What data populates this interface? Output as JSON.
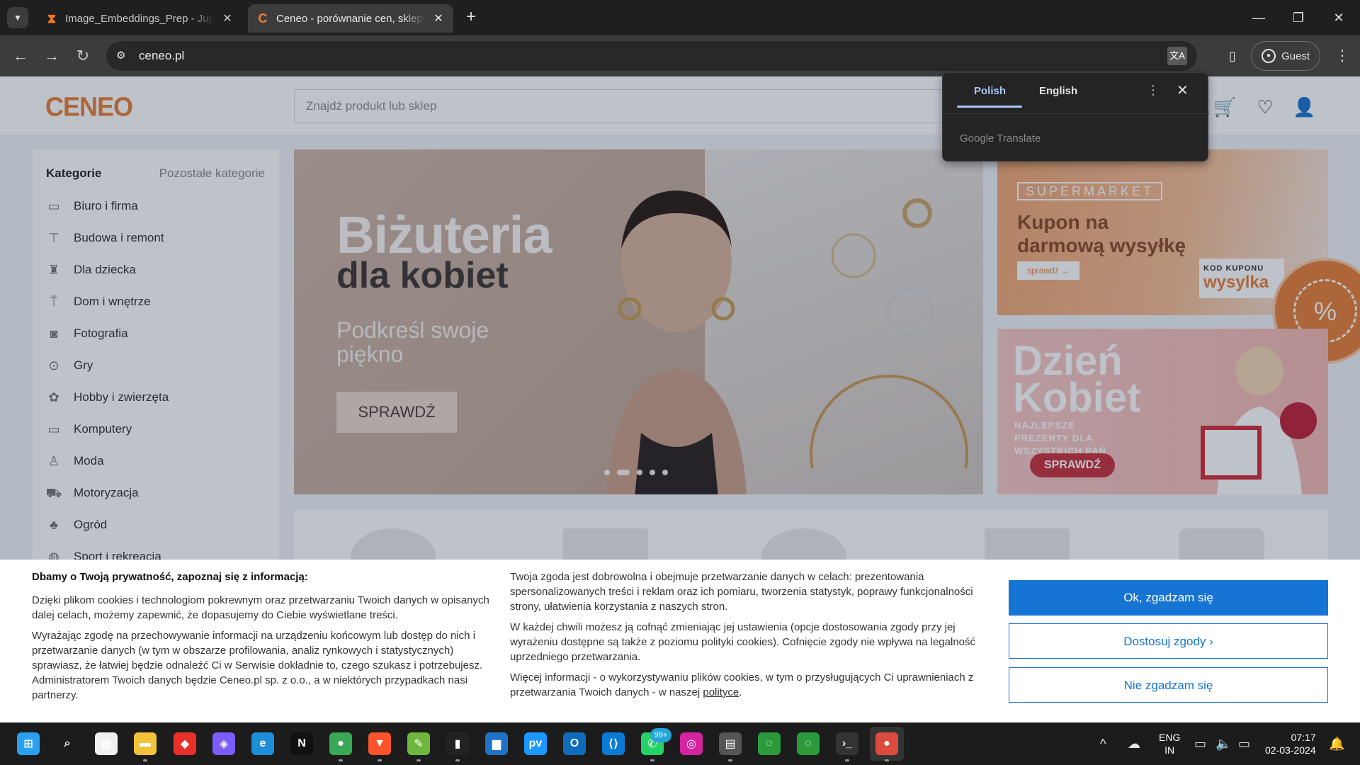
{
  "browser": {
    "tabs": [
      {
        "title": "Image_Embeddings_Prep - Jupyter",
        "favicon": "jupyter-icon",
        "active": false
      },
      {
        "title": "Ceneo - porównanie cen, sklepy",
        "favicon": "ceneo-icon",
        "active": true
      }
    ],
    "url": "ceneo.pl",
    "profile_label": "Guest"
  },
  "translate_popup": {
    "source_lang": "Polish",
    "target_lang": "English",
    "provider": "Google Translate"
  },
  "site": {
    "logo": "CENEO",
    "search_placeholder": "Znajdź produkt lub sklep",
    "sidebar": {
      "heading": "Kategorie",
      "other_link": "Pozostałe kategorie",
      "items": [
        {
          "label": "Biuro i firma",
          "icon": "office-icon"
        },
        {
          "label": "Budowa i remont",
          "icon": "paint-roller-icon"
        },
        {
          "label": "Dla dziecka",
          "icon": "toy-icon"
        },
        {
          "label": "Dom i wnętrze",
          "icon": "lamp-icon"
        },
        {
          "label": "Fotografia",
          "icon": "camera-icon"
        },
        {
          "label": "Gry",
          "icon": "gamepad-icon"
        },
        {
          "label": "Hobby i zwierzęta",
          "icon": "paw-icon"
        },
        {
          "label": "Komputery",
          "icon": "monitor-icon"
        },
        {
          "label": "Moda",
          "icon": "dress-icon"
        },
        {
          "label": "Motoryzacja",
          "icon": "car-icon"
        },
        {
          "label": "Ogród",
          "icon": "plant-icon"
        },
        {
          "label": "Sport i rekreacja",
          "icon": "ball-icon"
        }
      ]
    },
    "hero": {
      "title": "Biżuteria",
      "subtitle": "dla kobiet",
      "tagline": "Podkreśl swoje piękno",
      "cta": "SPRAWDŹ",
      "slides": 5,
      "active_slide": 2
    },
    "promo_supermarket": {
      "tag": "SUPERMARKET",
      "headline": "Kupon na darmową wysyłkę",
      "button": "sprawdź",
      "code_label": "KOD KUPONU",
      "code": "wysylka"
    },
    "promo_women": {
      "headline": "Dzień Kobiet",
      "sub": "NAJLEPSZE PREZENTY DLA WSZYSTKICH PAŃ",
      "button": "SPRAWDŹ"
    }
  },
  "cookie_banner": {
    "heading": "Dbamy o Twoją prywatność, zapoznaj się z informacją:",
    "col1_p1": "Dzięki plikom cookies i technologiom pokrewnym oraz przetwarzaniu Twoich danych w opisanych dalej celach, możemy zapewnić, że dopasujemy do Ciebie wyświetlane treści.",
    "col1_p2": "Wyrażając zgodę na przechowywanie informacji na urządzeniu końcowym lub dostęp do nich i przetwarzanie danych (w tym w obszarze profilowania, analiz rynkowych i statystycznych) sprawiasz, że łatwiej będzie odnaleźć Ci w Serwisie dokładnie to, czego szukasz i potrzebujesz. Administratorem Twoich danych będzie Ceneo.pl sp. z o.o., a w niektórych przypadkach nasi partnerzy.",
    "col2_p1": "Twoja zgoda jest dobrowolna i obejmuje przetwarzanie danych w celach: prezentowania spersonalizowanych treści i reklam oraz ich pomiaru, tworzenia statystyk, poprawy funkcjonalności strony, ułatwienia korzystania z naszych stron.",
    "col2_p2": "W każdej chwili możesz ją cofnąć zmieniając jej ustawienia (opcje dostosowania zgody przy jej wyrażeniu dostępne są także z poziomu polityki cookies). Cofnięcie zgody nie wpływa na legalność uprzedniego przetwarzania.",
    "col2_p3": "Więcej informacji - o wykorzystywaniu plików cookies, w tym o przysługujących Ci uprawnieniach z przetwarzania Twoich danych - w naszej",
    "policy_link": "polityce",
    "period": ".",
    "accept": "Ok, zgadzam się",
    "customize": "Dostosuj zgody ›",
    "reject": "Nie zgadzam się"
  },
  "taskbar": {
    "lang_line1": "ENG",
    "lang_line2": "IN",
    "time": "07:17",
    "date": "02-03-2024",
    "whatsapp_badge": "99+"
  }
}
